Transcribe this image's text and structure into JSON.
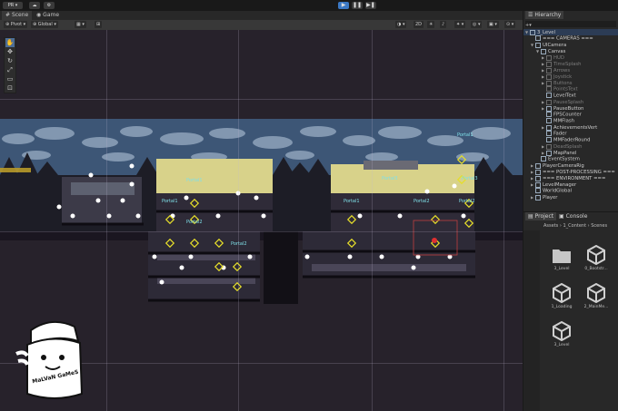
{
  "toolbar": {
    "account_label": "PR",
    "cloud_icon": "cloud-icon",
    "settings_icon": "gear-icon",
    "play_icon": "play-icon",
    "pause_icon": "pause-icon",
    "step_icon": "step-icon",
    "play_color": "#3b78c4"
  },
  "scene_tabs": [
    {
      "label": "Scene",
      "icon": "scene-icon"
    },
    {
      "label": "Game",
      "icon": "game-icon"
    }
  ],
  "scene_toolbar": {
    "pivot_label": "Pivot",
    "global_label": "Global",
    "grid_icon": "grid-icon",
    "snap_icon": "snap-icon"
  },
  "scene": {
    "portal_labels": [
      "Portal1",
      "Portal1",
      "Portal2",
      "Portal2",
      "Portal1",
      "Portal3",
      "Portal3",
      "Portal1",
      "Portal2",
      "Portal2"
    ],
    "background_color": "#27222b",
    "sky_color": "#3f5a78",
    "building_color": "#d8d28a",
    "tool_icons": [
      "hand-icon",
      "move-icon",
      "rotate-icon",
      "scale-icon",
      "rect-icon",
      "transform-icon"
    ]
  },
  "logo": {
    "text": "MaLVaN GaMeS"
  },
  "hierarchy": {
    "tab_label": "Hierarchy",
    "items": [
      {
        "label": "3_Level",
        "indent": 0,
        "arrow": "▼",
        "dim": false
      },
      {
        "label": "=== CAMERAS ===",
        "indent": 1,
        "arrow": "",
        "dim": false
      },
      {
        "label": "UICamera",
        "indent": 1,
        "arrow": "▼",
        "dim": false
      },
      {
        "label": "Canvas",
        "indent": 2,
        "arrow": "▼",
        "dim": false
      },
      {
        "label": "HUD",
        "indent": 3,
        "arrow": "▶",
        "dim": true
      },
      {
        "label": "TimeSplash",
        "indent": 3,
        "arrow": "▶",
        "dim": true
      },
      {
        "label": "Arrows",
        "indent": 3,
        "arrow": "▶",
        "dim": true
      },
      {
        "label": "Joystick",
        "indent": 3,
        "arrow": "▶",
        "dim": true
      },
      {
        "label": "Buttons",
        "indent": 3,
        "arrow": "▶",
        "dim": true
      },
      {
        "label": "PointsText",
        "indent": 3,
        "arrow": "",
        "dim": true
      },
      {
        "label": "LevelText",
        "indent": 3,
        "arrow": "",
        "dim": false
      },
      {
        "label": "PauseSplash",
        "indent": 3,
        "arrow": "▶",
        "dim": true
      },
      {
        "label": "PauseButton",
        "indent": 3,
        "arrow": "▶",
        "dim": false
      },
      {
        "label": "FPSCounter",
        "indent": 3,
        "arrow": "",
        "dim": false
      },
      {
        "label": "MMFlash",
        "indent": 3,
        "arrow": "",
        "dim": false
      },
      {
        "label": "AchievementsVert",
        "indent": 3,
        "arrow": "▶",
        "dim": false
      },
      {
        "label": "Fader",
        "indent": 3,
        "arrow": "",
        "dim": false
      },
      {
        "label": "MMFaderRound",
        "indent": 3,
        "arrow": "",
        "dim": false
      },
      {
        "label": "DeadSplash",
        "indent": 3,
        "arrow": "▶",
        "dim": true
      },
      {
        "label": "MapPanel",
        "indent": 3,
        "arrow": "▶",
        "dim": false
      },
      {
        "label": "EventSystem",
        "indent": 2,
        "arrow": "",
        "dim": false
      },
      {
        "label": "PlayerCameraRig",
        "indent": 1,
        "arrow": "▶",
        "dim": false
      },
      {
        "label": "=== POST-PROCESSING ===",
        "indent": 1,
        "arrow": "▶",
        "dim": false
      },
      {
        "label": "=== ENVIRONMENT ===",
        "indent": 1,
        "arrow": "▶",
        "dim": false
      },
      {
        "label": "LevelManager",
        "indent": 1,
        "arrow": "▶",
        "dim": false
      },
      {
        "label": "WorldGlobal",
        "indent": 1,
        "arrow": "",
        "dim": false
      },
      {
        "label": "Player",
        "indent": 1,
        "arrow": "▶",
        "dim": false
      }
    ]
  },
  "project": {
    "tabs": [
      {
        "label": "Project",
        "icon": "folder-icon"
      },
      {
        "label": "Console",
        "icon": "console-icon"
      }
    ],
    "breadcrumb": [
      "Assets",
      "1_Content",
      "Scenes"
    ],
    "assets": [
      {
        "label": "3_Level",
        "icon": "folder-icon"
      },
      {
        "label": "0_Bootstr...",
        "icon": "unity-scene-icon"
      },
      {
        "label": "1_Loading",
        "icon": "unity-scene-icon"
      },
      {
        "label": "2_MainMe...",
        "icon": "unity-scene-icon"
      },
      {
        "label": "3_Level",
        "icon": "unity-scene-icon"
      }
    ]
  }
}
